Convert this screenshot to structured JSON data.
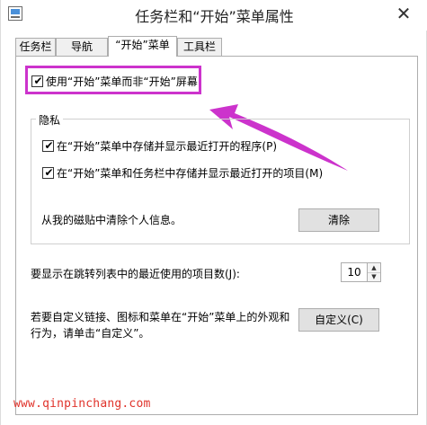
{
  "window": {
    "title": "任务栏和“开始”菜单属性",
    "close_glyph": "✕"
  },
  "tabs": [
    {
      "label": "任务栏"
    },
    {
      "label": "导航"
    },
    {
      "label": "“开始”菜单",
      "active": true
    },
    {
      "label": "工具栏"
    }
  ],
  "main": {
    "use_start_menu": {
      "label": "使用“开始”菜单而非“开始”屏幕",
      "checked": true
    },
    "privacy": {
      "title": "隐私",
      "store_programs": {
        "label": "在“开始”菜单中存储并显示最近打开的程序(P)",
        "checked": true
      },
      "store_items": {
        "label": "在“开始”菜单和任务栏中存储并显示最近打开的项目(M)",
        "checked": true
      },
      "clear_text": "从我的磁贴中清除个人信息。",
      "clear_button": "清除"
    },
    "jump_list": {
      "label": "要显示在跳转列表中的最近使用的项目数(J):",
      "value": "10",
      "up_glyph": "▲",
      "down_glyph": "▼"
    },
    "customize": {
      "line1": "若要自定义链接、图标和菜单在“开始”菜单上的外观和",
      "line2": "行为，请单击“自定义”。",
      "button": "自定义(C)"
    }
  },
  "annotation": {
    "color": "#cc33cc"
  },
  "watermark": "www.qinpinchang.com",
  "check_glyph": "✔"
}
